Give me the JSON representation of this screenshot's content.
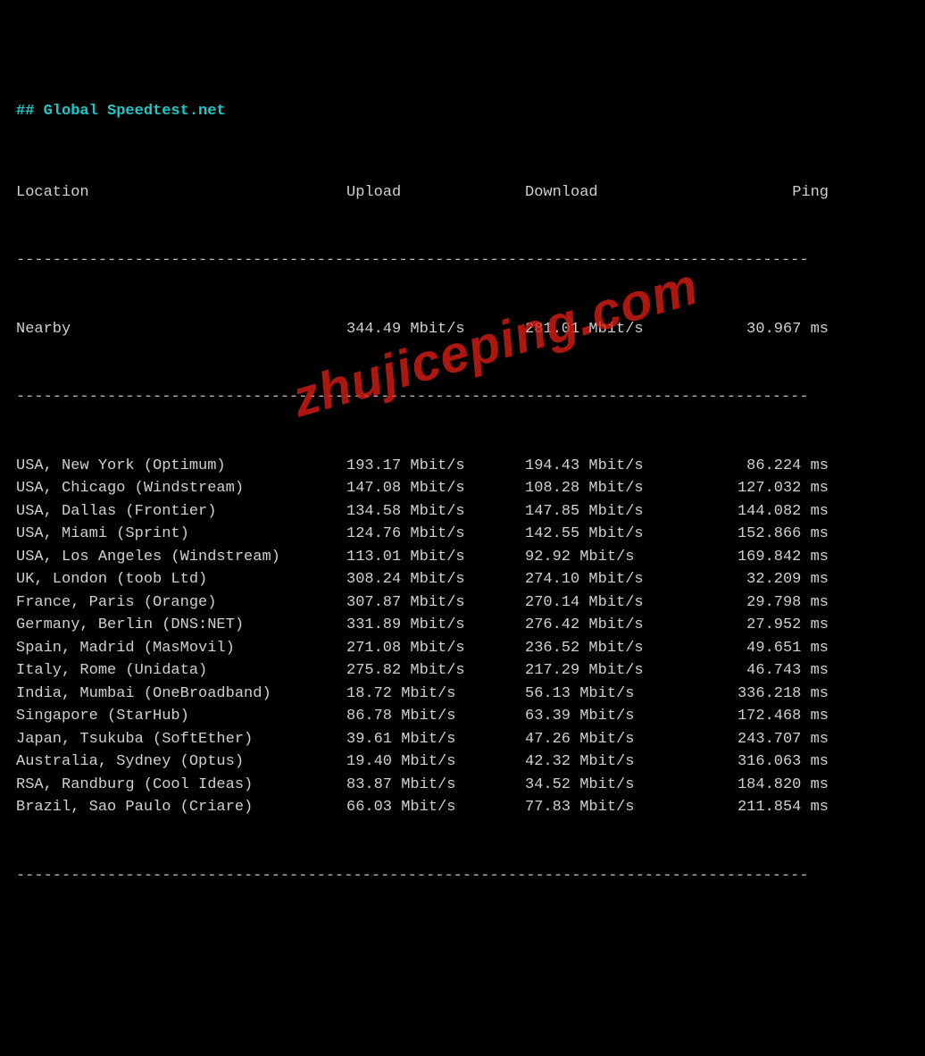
{
  "title": "## Global Speedtest.net",
  "headers": {
    "loc": "Location",
    "up": "Upload",
    "dn": "Download",
    "ping": "Ping"
  },
  "dash_line": "---------------------------------------------------------------------------------------",
  "nearby": {
    "loc": "Nearby",
    "up": "344.49 Mbit/s",
    "dn": "281.01 Mbit/s",
    "ping": "30.967 ms"
  },
  "watermark": "zhujiceping.com",
  "chart_data": {
    "type": "table",
    "title": "Global Speedtest.net",
    "columns": [
      "Location",
      "Upload (Mbit/s)",
      "Download (Mbit/s)",
      "Ping (ms)"
    ],
    "nearby": {
      "location": "Nearby",
      "upload_mbps": 344.49,
      "download_mbps": 281.01,
      "ping_ms": 30.967
    },
    "rows": [
      {
        "location": "USA, New York (Optimum)",
        "upload_mbps": 193.17,
        "download_mbps": 194.43,
        "ping_ms": 86.224
      },
      {
        "location": "USA, Chicago (Windstream)",
        "upload_mbps": 147.08,
        "download_mbps": 108.28,
        "ping_ms": 127.032
      },
      {
        "location": "USA, Dallas (Frontier)",
        "upload_mbps": 134.58,
        "download_mbps": 147.85,
        "ping_ms": 144.082
      },
      {
        "location": "USA, Miami (Sprint)",
        "upload_mbps": 124.76,
        "download_mbps": 142.55,
        "ping_ms": 152.866
      },
      {
        "location": "USA, Los Angeles (Windstream)",
        "upload_mbps": 113.01,
        "download_mbps": 92.92,
        "ping_ms": 169.842
      },
      {
        "location": "UK, London (toob Ltd)",
        "upload_mbps": 308.24,
        "download_mbps": 274.1,
        "ping_ms": 32.209
      },
      {
        "location": "France, Paris (Orange)",
        "upload_mbps": 307.87,
        "download_mbps": 270.14,
        "ping_ms": 29.798
      },
      {
        "location": "Germany, Berlin (DNS:NET)",
        "upload_mbps": 331.89,
        "download_mbps": 276.42,
        "ping_ms": 27.952
      },
      {
        "location": "Spain, Madrid (MasMovil)",
        "upload_mbps": 271.08,
        "download_mbps": 236.52,
        "ping_ms": 49.651
      },
      {
        "location": "Italy, Rome (Unidata)",
        "upload_mbps": 275.82,
        "download_mbps": 217.29,
        "ping_ms": 46.743
      },
      {
        "location": "India, Mumbai (OneBroadband)",
        "upload_mbps": 18.72,
        "download_mbps": 56.13,
        "ping_ms": 336.218
      },
      {
        "location": "Singapore (StarHub)",
        "upload_mbps": 86.78,
        "download_mbps": 63.39,
        "ping_ms": 172.468
      },
      {
        "location": "Japan, Tsukuba (SoftEther)",
        "upload_mbps": 39.61,
        "download_mbps": 47.26,
        "ping_ms": 243.707
      },
      {
        "location": "Australia, Sydney (Optus)",
        "upload_mbps": 19.4,
        "download_mbps": 42.32,
        "ping_ms": 316.063
      },
      {
        "location": "RSA, Randburg (Cool Ideas)",
        "upload_mbps": 83.87,
        "download_mbps": 34.52,
        "ping_ms": 184.82
      },
      {
        "location": "Brazil, Sao Paulo (Criare)",
        "upload_mbps": 66.03,
        "download_mbps": 77.83,
        "ping_ms": 211.854
      }
    ]
  },
  "displayRows": [
    {
      "loc": "USA, New York (Optimum)",
      "up": "193.17 Mbit/s",
      "dn": "194.43 Mbit/s",
      "ping": "86.224 ms"
    },
    {
      "loc": "USA, Chicago (Windstream)",
      "up": "147.08 Mbit/s",
      "dn": "108.28 Mbit/s",
      "ping": "127.032 ms"
    },
    {
      "loc": "USA, Dallas (Frontier)",
      "up": "134.58 Mbit/s",
      "dn": "147.85 Mbit/s",
      "ping": "144.082 ms"
    },
    {
      "loc": "USA, Miami (Sprint)",
      "up": "124.76 Mbit/s",
      "dn": "142.55 Mbit/s",
      "ping": "152.866 ms"
    },
    {
      "loc": "USA, Los Angeles (Windstream)",
      "up": "113.01 Mbit/s",
      "dn": "92.92 Mbit/s",
      "ping": "169.842 ms"
    },
    {
      "loc": "UK, London (toob Ltd)",
      "up": "308.24 Mbit/s",
      "dn": "274.10 Mbit/s",
      "ping": "32.209 ms"
    },
    {
      "loc": "France, Paris (Orange)",
      "up": "307.87 Mbit/s",
      "dn": "270.14 Mbit/s",
      "ping": "29.798 ms"
    },
    {
      "loc": "Germany, Berlin (DNS:NET)",
      "up": "331.89 Mbit/s",
      "dn": "276.42 Mbit/s",
      "ping": "27.952 ms"
    },
    {
      "loc": "Spain, Madrid (MasMovil)",
      "up": "271.08 Mbit/s",
      "dn": "236.52 Mbit/s",
      "ping": "49.651 ms"
    },
    {
      "loc": "Italy, Rome (Unidata)",
      "up": "275.82 Mbit/s",
      "dn": "217.29 Mbit/s",
      "ping": "46.743 ms"
    },
    {
      "loc": "India, Mumbai (OneBroadband)",
      "up": "18.72 Mbit/s",
      "dn": "56.13 Mbit/s",
      "ping": "336.218 ms"
    },
    {
      "loc": "Singapore (StarHub)",
      "up": "86.78 Mbit/s",
      "dn": "63.39 Mbit/s",
      "ping": "172.468 ms"
    },
    {
      "loc": "Japan, Tsukuba (SoftEther)",
      "up": "39.61 Mbit/s",
      "dn": "47.26 Mbit/s",
      "ping": "243.707 ms"
    },
    {
      "loc": "Australia, Sydney (Optus)",
      "up": "19.40 Mbit/s",
      "dn": "42.32 Mbit/s",
      "ping": "316.063 ms"
    },
    {
      "loc": "RSA, Randburg (Cool Ideas)",
      "up": "83.87 Mbit/s",
      "dn": "34.52 Mbit/s",
      "ping": "184.820 ms"
    },
    {
      "loc": "Brazil, Sao Paulo (Criare)",
      "up": "66.03 Mbit/s",
      "dn": "77.83 Mbit/s",
      "ping": "211.854 ms"
    }
  ]
}
